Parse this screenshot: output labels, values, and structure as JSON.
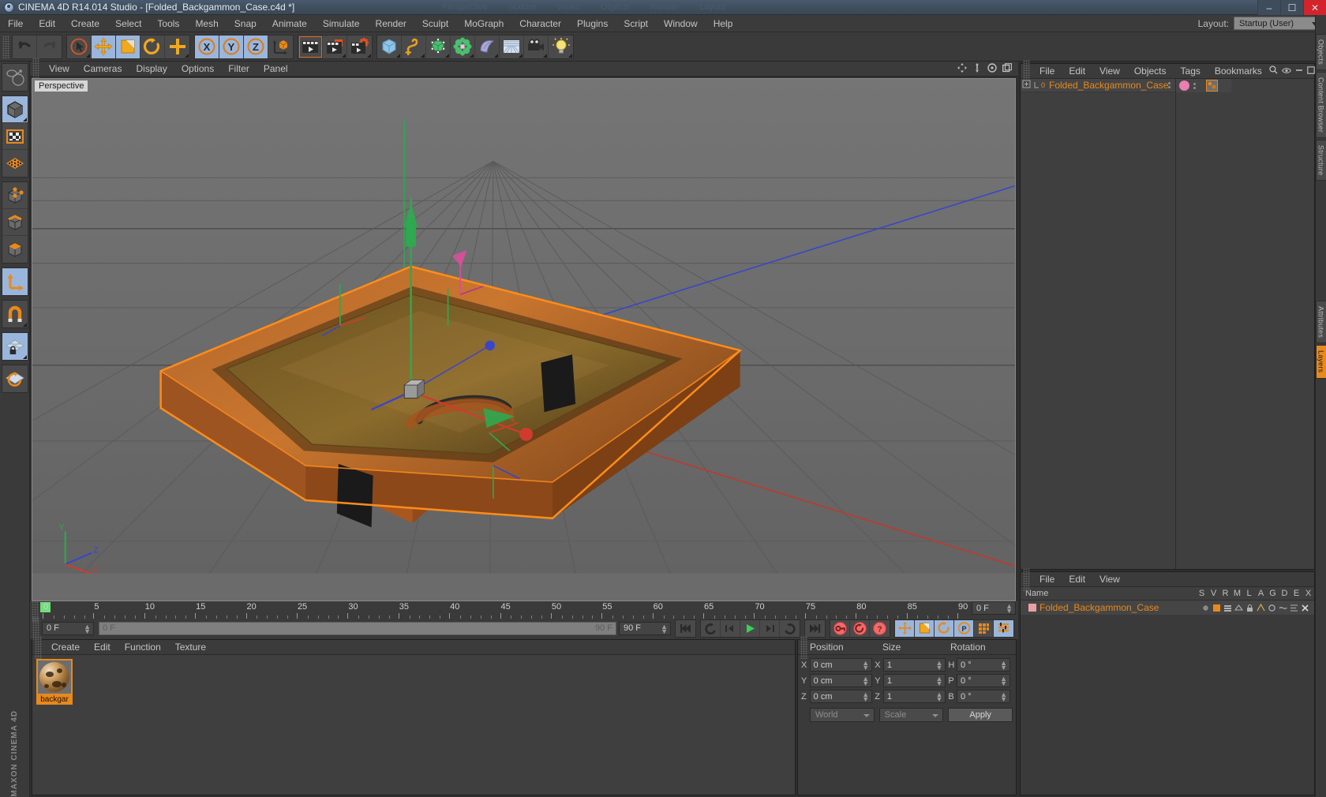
{
  "window": {
    "title": "CINEMA 4D R14.014 Studio - [Folded_Backgammon_Case.c4d *]",
    "logo_icon": "c4d-logo-icon",
    "minimize_label": "–",
    "maximize_label": "☐",
    "close_label": "✕",
    "ghost_tabs": [
      "Perspective",
      "Texture",
      "Views",
      "Objects",
      "Render",
      "Layout"
    ]
  },
  "menu": {
    "items": [
      "File",
      "Edit",
      "Create",
      "Select",
      "Tools",
      "Mesh",
      "Snap",
      "Animate",
      "Simulate",
      "Render",
      "Sculpt",
      "MoGraph",
      "Character",
      "Plugins",
      "Script",
      "Window",
      "Help"
    ],
    "layout_label": "Layout:",
    "layout_value": "Startup (User)"
  },
  "toolbar": {
    "groups": [
      {
        "name": "undo-redo",
        "buttons": [
          {
            "name": "undo-button",
            "icon": "undo-arrow-icon",
            "state": "normal"
          },
          {
            "name": "redo-button",
            "icon": "redo-arrow-icon",
            "state": "disabled"
          }
        ]
      },
      {
        "name": "transform-tools",
        "buttons": [
          {
            "name": "live-selection-tool",
            "icon": "cursor-circle-icon",
            "state": "normal"
          },
          {
            "name": "move-tool",
            "icon": "move-arrows-icon",
            "state": "active"
          },
          {
            "name": "scale-tool",
            "icon": "scale-square-icon",
            "state": "active"
          },
          {
            "name": "rotate-tool",
            "icon": "rotate-arc-icon",
            "state": "normal"
          },
          {
            "name": "add-tool",
            "icon": "plus-cross-icon",
            "state": "normal"
          }
        ]
      },
      {
        "name": "axis-locks",
        "buttons": [
          {
            "name": "x-axis-lock",
            "icon": "x-axis-icon",
            "state": "active"
          },
          {
            "name": "y-axis-lock",
            "icon": "y-axis-icon",
            "state": "active"
          },
          {
            "name": "z-axis-lock",
            "icon": "z-axis-icon",
            "state": "active"
          },
          {
            "name": "world-object-coords",
            "icon": "world-axis-cube-icon",
            "state": "normal"
          }
        ]
      },
      {
        "name": "render-group",
        "buttons": [
          {
            "name": "render-view-button",
            "icon": "clapper-render-icon",
            "state": "selected"
          },
          {
            "name": "render-to-picture-viewer-button",
            "icon": "clapper-picture-icon",
            "state": "normal"
          },
          {
            "name": "render-settings-button",
            "icon": "clapper-gear-icon",
            "state": "normal"
          }
        ]
      },
      {
        "name": "object-group",
        "buttons": [
          {
            "name": "add-cube-button",
            "icon": "cube-icon",
            "state": "normal"
          },
          {
            "name": "add-spline-button",
            "icon": "spline-pen-icon",
            "state": "normal"
          },
          {
            "name": "add-generator-button",
            "icon": "nurbs-green-cube-icon",
            "state": "normal"
          },
          {
            "name": "add-deformer-button",
            "icon": "deformer-green-icon",
            "state": "normal"
          },
          {
            "name": "add-scene-object-button",
            "icon": "floor-sky-icon",
            "state": "normal"
          },
          {
            "name": "add-environment-button",
            "icon": "environment-grid-icon",
            "state": "normal"
          },
          {
            "name": "add-camera-button",
            "icon": "camera-icon",
            "state": "normal"
          },
          {
            "name": "add-light-button",
            "icon": "light-bulb-icon",
            "state": "normal"
          }
        ]
      }
    ]
  },
  "left_tools": {
    "groups": [
      {
        "buttons": [
          {
            "name": "undo-view-button",
            "icon": "globe-sphere-icon",
            "state": "normal"
          }
        ]
      },
      {
        "buttons": [
          {
            "name": "make-editable-button",
            "icon": "editable-cube-icon",
            "state": "active"
          },
          {
            "name": "texture-mode-button",
            "icon": "checker-texture-icon",
            "state": "normal"
          },
          {
            "name": "viewport-solo-button",
            "icon": "orange-grid-icon",
            "state": "normal"
          }
        ]
      },
      {
        "buttons": [
          {
            "name": "points-mode-button",
            "icon": "points-cube-icon",
            "state": "normal"
          },
          {
            "name": "edges-mode-button",
            "icon": "edges-cube-icon",
            "state": "normal"
          },
          {
            "name": "polygons-mode-button",
            "icon": "polygons-cube-icon",
            "state": "normal"
          }
        ]
      },
      {
        "buttons": [
          {
            "name": "object-axis-mode-button",
            "icon": "axis-arrows-icon",
            "state": "active"
          }
        ]
      },
      {
        "buttons": [
          {
            "name": "enable-snap-button",
            "icon": "magnet-icon",
            "state": "normal"
          }
        ]
      },
      {
        "buttons": [
          {
            "name": "workplane-lock-button",
            "icon": "grid-lock-icon",
            "state": "active"
          }
        ]
      },
      {
        "buttons": [
          {
            "name": "workplane-rotate-button",
            "icon": "grid-rotate-icon",
            "state": "normal"
          }
        ]
      }
    ],
    "branding_line1": "MAXON",
    "branding_line2": "CINEMA 4D"
  },
  "viewport": {
    "menu_items": [
      "View",
      "Cameras",
      "Display",
      "Options",
      "Filter",
      "Panel"
    ],
    "label": "Perspective",
    "corner_icons": [
      "pan-icon",
      "dolly-icon",
      "orbit-icon",
      "maximize-view-icon"
    ],
    "axis_labels": {
      "x": "X",
      "y": "Y",
      "z": "Z"
    },
    "selected_object_outline_color": "#ff8c1a"
  },
  "timeline": {
    "ruler_labels": [
      "0",
      "5",
      "10",
      "15",
      "20",
      "25",
      "30",
      "35",
      "40",
      "45",
      "50",
      "55",
      "60",
      "65",
      "70",
      "75",
      "80",
      "85",
      "90"
    ],
    "ruler_min": 0,
    "ruler_max": 90,
    "current_frame_display": "0 F",
    "current_frame_field": "0 F",
    "scrollbar_left_label": "0 F",
    "scrollbar_right_label": "90 F",
    "end_frame_field": "90 F",
    "transport": [
      {
        "name": "go-to-start-button",
        "icon": "skip-start-icon"
      },
      {
        "name": "go-to-previous-key-button",
        "icon": "prev-key-icon"
      },
      {
        "name": "step-back-button",
        "icon": "step-back-icon"
      },
      {
        "name": "play-button",
        "icon": "play-icon"
      },
      {
        "name": "step-forward-button",
        "icon": "step-forward-icon"
      },
      {
        "name": "go-to-next-key-button",
        "icon": "next-key-icon"
      },
      {
        "name": "go-to-end-button",
        "icon": "skip-end-icon"
      }
    ],
    "record_buttons": [
      {
        "name": "record-active-objects-button",
        "icon": "record-key-icon"
      },
      {
        "name": "autokeying-button",
        "icon": "autokey-icon"
      },
      {
        "name": "keyframe-selection-button",
        "icon": "question-key-icon"
      }
    ],
    "key_toggles": [
      {
        "name": "position-key-toggle",
        "icon": "move-arrows-icon",
        "state": "active"
      },
      {
        "name": "scale-key-toggle",
        "icon": "scale-square-icon",
        "state": "active"
      },
      {
        "name": "rotation-key-toggle",
        "icon": "rotate-arc-icon",
        "state": "active"
      },
      {
        "name": "parameter-key-toggle",
        "icon": "param-p-icon",
        "state": "active"
      },
      {
        "name": "pla-key-toggle",
        "icon": "pla-grid-icon",
        "state": "normal"
      },
      {
        "name": "timeline-toggle",
        "icon": "timeline-bars-icon",
        "state": "active"
      }
    ]
  },
  "material_manager": {
    "menu_items": [
      "Create",
      "Edit",
      "Function",
      "Texture"
    ],
    "materials": [
      {
        "name": "backgammon-material",
        "label": "backgar"
      }
    ]
  },
  "coordinate_manager": {
    "headers": [
      "Position",
      "Size",
      "Rotation"
    ],
    "rows": [
      {
        "pos_axis": "X",
        "pos_value": "0 cm",
        "size_axis": "X",
        "size_value": "1",
        "rot_axis": "H",
        "rot_value": "0 °"
      },
      {
        "pos_axis": "Y",
        "pos_value": "0 cm",
        "size_axis": "Y",
        "size_value": "1",
        "rot_axis": "P",
        "rot_value": "0 °"
      },
      {
        "pos_axis": "Z",
        "pos_value": "0 cm",
        "size_axis": "Z",
        "size_value": "1",
        "rot_axis": "B",
        "rot_value": "0 °"
      }
    ],
    "coord_system": "World",
    "size_mode": "Scale",
    "apply_label": "Apply"
  },
  "object_manager": {
    "menu_items": [
      "File",
      "Edit",
      "View",
      "Objects",
      "Tags",
      "Bookmarks"
    ],
    "toolbar_icons": [
      "search-icon",
      "eye-icon",
      "collapse-icon",
      "expand-icon"
    ],
    "objects": [
      {
        "name": "Folded_Backgammon_Case",
        "level": 0,
        "layer_badge": "0",
        "tags": [
          "material-tag",
          "texture-tag"
        ]
      }
    ]
  },
  "attribute_manager": {
    "menu_items": [
      "File",
      "Edit",
      "View"
    ],
    "columns": [
      "Name",
      "S",
      "V",
      "R",
      "M",
      "L",
      "A",
      "G",
      "D",
      "E",
      "X"
    ],
    "rows": [
      {
        "name": "Folded_Backgammon_Case"
      }
    ]
  },
  "right_tabs": [
    {
      "label": "Objects",
      "active": false
    },
    {
      "label": "Content Browser",
      "active": false
    },
    {
      "label": "Structure",
      "active": false
    },
    {
      "label": "Attributes",
      "active": false
    },
    {
      "label": "Layers",
      "active": true
    }
  ],
  "colors": {
    "accent_orange": "#e8891c",
    "selection_blue": "#9ab6dc",
    "titlebar_blue": "#41505f",
    "panel_bg": "#3a3a3a",
    "viewport_bg": "#6b6b6b",
    "close_red": "#d4242b"
  }
}
